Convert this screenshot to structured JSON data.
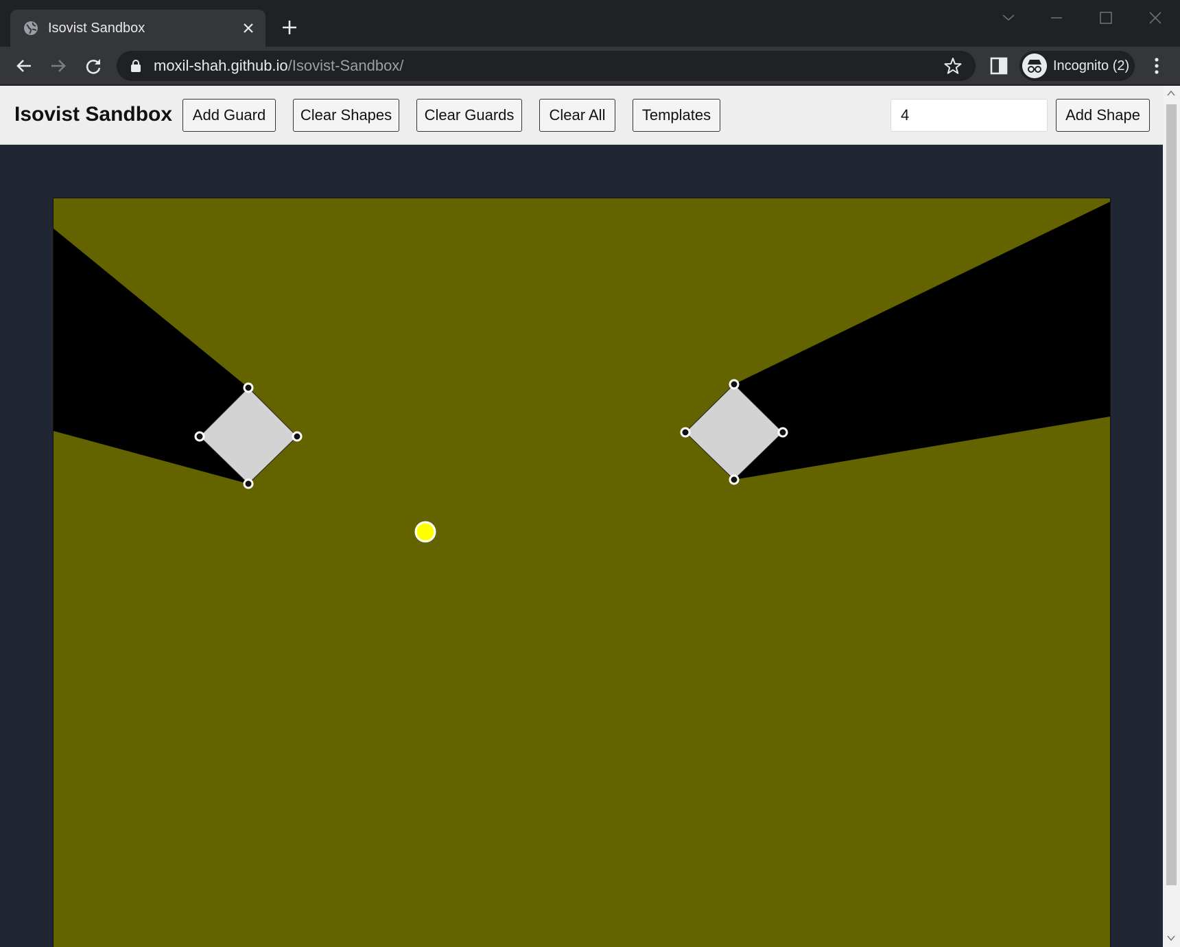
{
  "browser": {
    "tab_title": "Isovist Sandbox",
    "url_host": "moxil-shah.github.io",
    "url_path": "/Isovist-Sandbox/",
    "profile_label": "Incognito (2)",
    "icons": [
      "globe-icon",
      "close-icon",
      "plus-icon",
      "chevron-down-icon",
      "minimize-icon",
      "maximize-icon",
      "window-close-icon",
      "back-arrow-icon",
      "forward-arrow-icon",
      "reload-icon",
      "lock-icon",
      "star-icon",
      "side-panel-icon",
      "incognito-icon",
      "kebab-menu-icon"
    ]
  },
  "header": {
    "title": "Isovist Sandbox",
    "buttons": {
      "add_guard": "Add Guard",
      "clear_shapes": "Clear Shapes",
      "clear_guards": "Clear Guards",
      "clear_all": "Clear All",
      "templates": "Templates",
      "add_shape": "Add Shape"
    },
    "sides_input_value": "4"
  },
  "colors": {
    "visible_region": "#636300",
    "shadow_region": "#000000",
    "shape_fill": "#d3d3d3",
    "guard": "#ffff00",
    "vertex_handle": "#ffffff",
    "page_background": "#202632",
    "header_background": "#eeeeee"
  },
  "scene": {
    "shape_count": 2,
    "vertices_per_shape": 4,
    "guard_count": 1
  }
}
